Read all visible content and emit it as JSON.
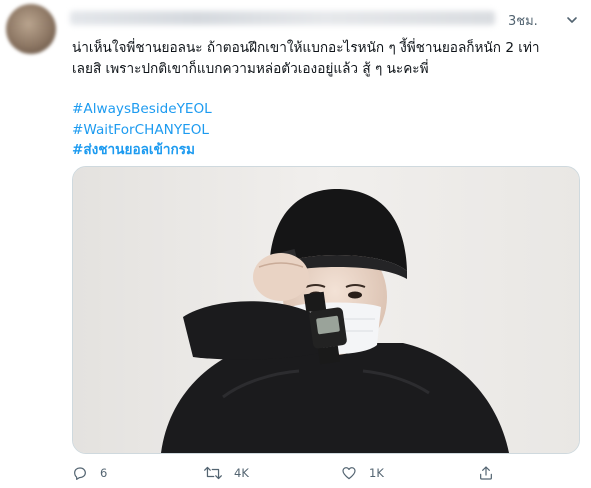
{
  "tweet": {
    "timestamp": "3ชม.",
    "text_lines": [
      "น่าเห็นใจพี่ชานยอลนะ ถ้าตอนฝึกเขาให้แบกอะไรหนัก ๆ งี้พี่ชานยอลก็หนัก 2 เท่า",
      "เลยสิ เพราะปกติเขาก็แบกความหล่อตัวเองอยู่แล้ว สู้ ๆ นะคะพี่"
    ],
    "hashtags": [
      "#AlwaysBesideYEOL",
      "#WaitForCHANYEOL",
      "#ส่งชานยอลเข้ากรม"
    ]
  },
  "actions": {
    "reply_count": "6",
    "retweet_count": "4K",
    "like_count": "1K"
  },
  "icons": {
    "more": "chevron-down-icon",
    "reply": "reply-icon",
    "retweet": "retweet-icon",
    "like": "heart-icon",
    "share": "share-icon"
  },
  "colors": {
    "link": "#1d9bf0",
    "muted": "#536471",
    "text": "#0f1419"
  }
}
